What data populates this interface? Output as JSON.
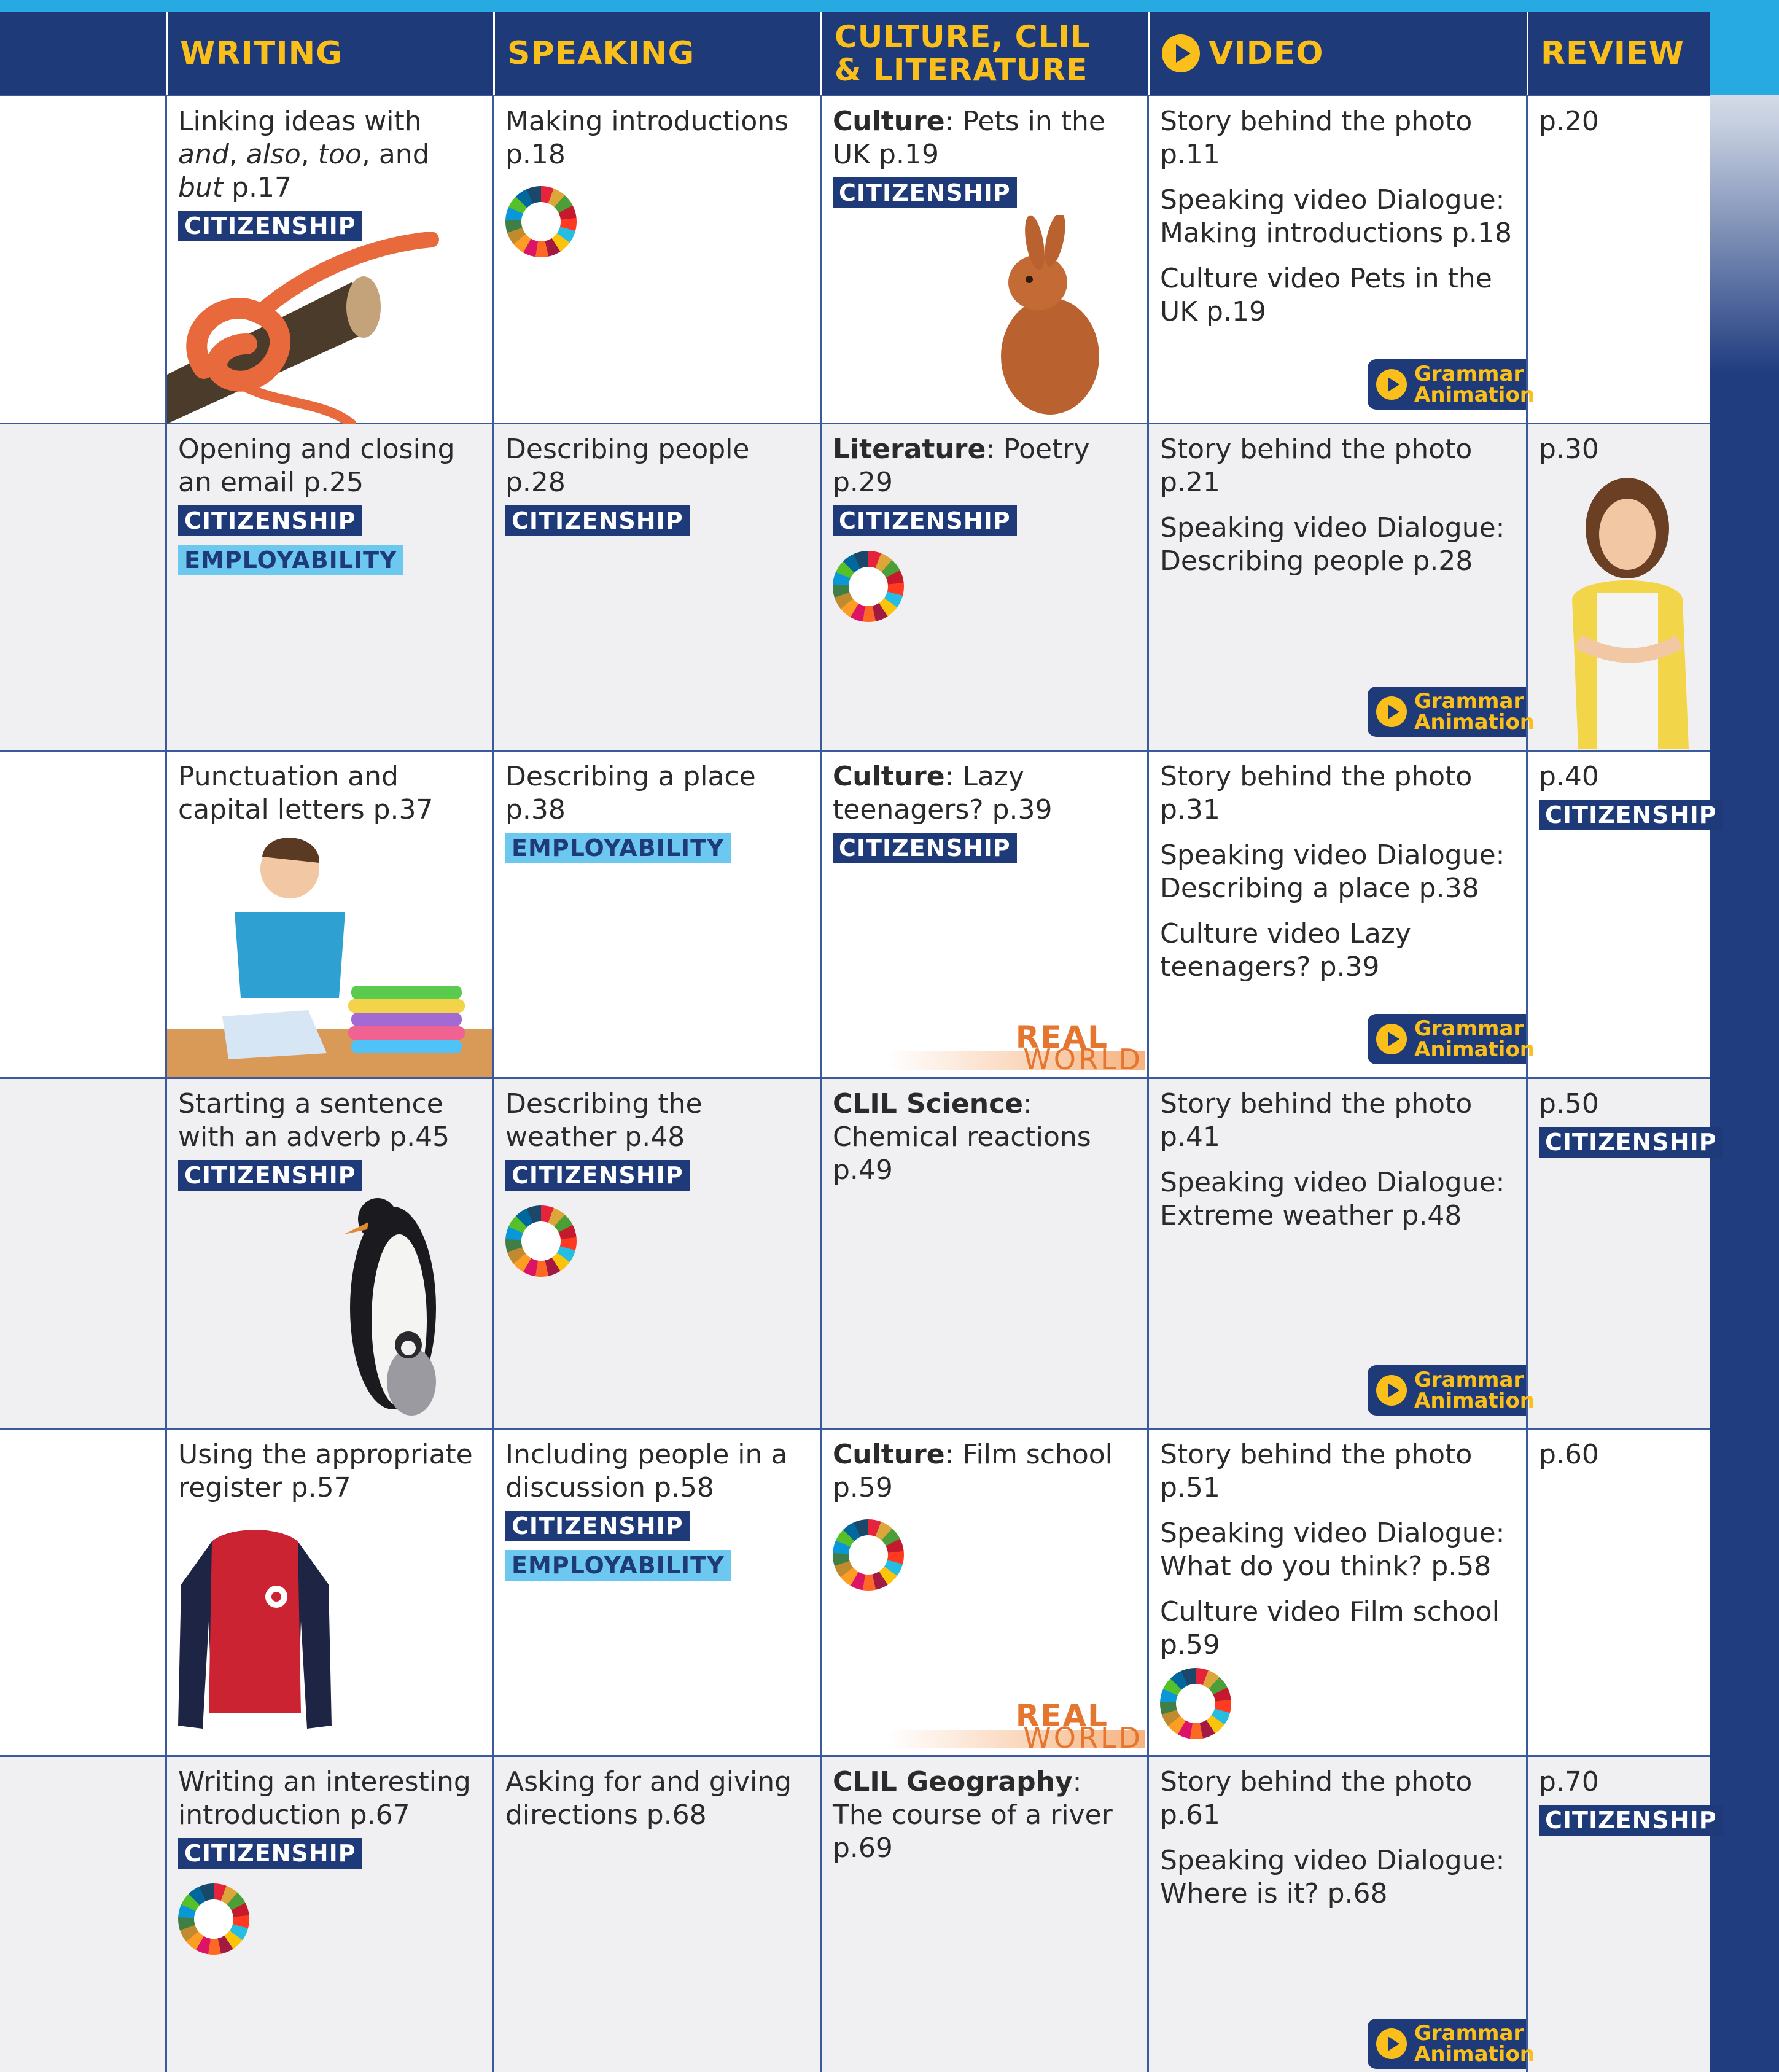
{
  "header": {
    "writing": "WRITING",
    "speaking": "SPEAKING",
    "culture_l1": "CULTURE, CLIL",
    "culture_l2": "& LITERATURE",
    "video": "VIDEO",
    "review": "REVIEW"
  },
  "tags": {
    "citizenship": "CITIZENSHIP",
    "employability": "EMPLOYABILITY"
  },
  "grammar_animation": {
    "l1": "Grammar",
    "l2": "Animation"
  },
  "real_world": {
    "l1": "REAL",
    "l2": "WORLD"
  },
  "rows": [
    {
      "writing_a": "Linking ideas with ",
      "writing_i1": "and",
      "writing_b": ", ",
      "writing_i2": "also",
      "writing_c": ", ",
      "writing_i3": "too",
      "writing_d": ", and ",
      "writing_i4": "but",
      "writing_e": " p.17",
      "speaking": "Making introductions p.18",
      "culture_b": "Culture",
      "culture": ": Pets in the UK p.19",
      "video": [
        "Story behind the photo p.11",
        "Speaking video Dialogue: Making introductions p.18",
        "Culture video Pets in the UK p.19"
      ],
      "review": "p.20"
    },
    {
      "writing": "Opening and closing an email p.25",
      "speaking": "Describing people p.28",
      "culture_b": "Literature",
      "culture": ": Poetry p.29",
      "video": [
        "Story behind the photo p.21",
        "Speaking video Dialogue: Describing people p.28"
      ],
      "review": "p.30"
    },
    {
      "writing": "Punctuation and capital letters p.37",
      "speaking": "Describing a place p.38",
      "culture_b": "Culture",
      "culture": ": Lazy teenagers? p.39",
      "video": [
        "Story behind the photo p.31",
        "Speaking video Dialogue: Describing a place p.38",
        "Culture video Lazy teenagers? p.39"
      ],
      "review": "p.40"
    },
    {
      "writing": "Starting a sentence with an adverb p.45",
      "speaking": "Describing the weather p.48",
      "culture_b": "CLIL Science",
      "culture": ": Chemical reactions p.49",
      "video": [
        "Story behind the photo p.41",
        "Speaking video Dialogue: Extreme weather p.48"
      ],
      "review": "p.50"
    },
    {
      "writing": "Using the appropriate register p.57",
      "speaking": "Including people in a discussion p.58",
      "culture_b": "Culture",
      "culture": ": Film school p.59",
      "video": [
        "Story behind the photo p.51",
        "Speaking video Dialogue: What do you think? p.58",
        "Culture video Film school p.59"
      ],
      "review": "p.60"
    },
    {
      "writing": "Writing an interesting introduction p.67",
      "speaking": "Asking for and giving directions p.68",
      "culture_b": "CLIL Geography",
      "culture": ": The course of a river p.69",
      "video": [
        "Story behind the photo p.61",
        "Speaking video Dialogue: Where is it? p.68"
      ],
      "review": "p.70"
    }
  ]
}
